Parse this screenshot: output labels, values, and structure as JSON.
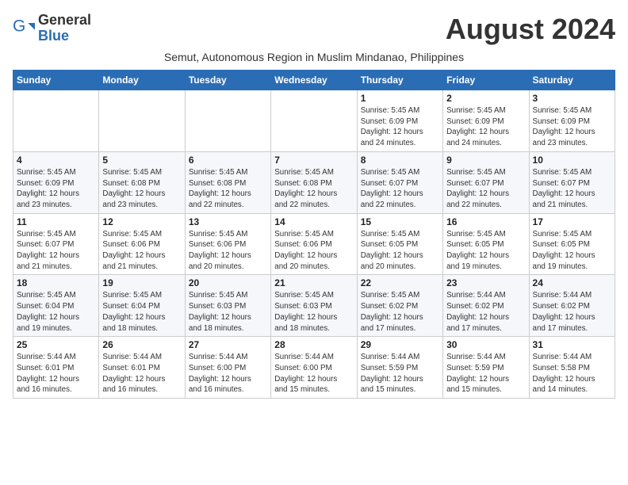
{
  "header": {
    "logo_line1": "General",
    "logo_line2": "Blue",
    "month": "August 2024",
    "subtitle": "Semut, Autonomous Region in Muslim Mindanao, Philippines"
  },
  "days_of_week": [
    "Sunday",
    "Monday",
    "Tuesday",
    "Wednesday",
    "Thursday",
    "Friday",
    "Saturday"
  ],
  "weeks": [
    [
      {
        "day": "",
        "info": ""
      },
      {
        "day": "",
        "info": ""
      },
      {
        "day": "",
        "info": ""
      },
      {
        "day": "",
        "info": ""
      },
      {
        "day": "1",
        "info": "Sunrise: 5:45 AM\nSunset: 6:09 PM\nDaylight: 12 hours\nand 24 minutes."
      },
      {
        "day": "2",
        "info": "Sunrise: 5:45 AM\nSunset: 6:09 PM\nDaylight: 12 hours\nand 24 minutes."
      },
      {
        "day": "3",
        "info": "Sunrise: 5:45 AM\nSunset: 6:09 PM\nDaylight: 12 hours\nand 23 minutes."
      }
    ],
    [
      {
        "day": "4",
        "info": "Sunrise: 5:45 AM\nSunset: 6:09 PM\nDaylight: 12 hours\nand 23 minutes."
      },
      {
        "day": "5",
        "info": "Sunrise: 5:45 AM\nSunset: 6:08 PM\nDaylight: 12 hours\nand 23 minutes."
      },
      {
        "day": "6",
        "info": "Sunrise: 5:45 AM\nSunset: 6:08 PM\nDaylight: 12 hours\nand 22 minutes."
      },
      {
        "day": "7",
        "info": "Sunrise: 5:45 AM\nSunset: 6:08 PM\nDaylight: 12 hours\nand 22 minutes."
      },
      {
        "day": "8",
        "info": "Sunrise: 5:45 AM\nSunset: 6:07 PM\nDaylight: 12 hours\nand 22 minutes."
      },
      {
        "day": "9",
        "info": "Sunrise: 5:45 AM\nSunset: 6:07 PM\nDaylight: 12 hours\nand 22 minutes."
      },
      {
        "day": "10",
        "info": "Sunrise: 5:45 AM\nSunset: 6:07 PM\nDaylight: 12 hours\nand 21 minutes."
      }
    ],
    [
      {
        "day": "11",
        "info": "Sunrise: 5:45 AM\nSunset: 6:07 PM\nDaylight: 12 hours\nand 21 minutes."
      },
      {
        "day": "12",
        "info": "Sunrise: 5:45 AM\nSunset: 6:06 PM\nDaylight: 12 hours\nand 21 minutes."
      },
      {
        "day": "13",
        "info": "Sunrise: 5:45 AM\nSunset: 6:06 PM\nDaylight: 12 hours\nand 20 minutes."
      },
      {
        "day": "14",
        "info": "Sunrise: 5:45 AM\nSunset: 6:06 PM\nDaylight: 12 hours\nand 20 minutes."
      },
      {
        "day": "15",
        "info": "Sunrise: 5:45 AM\nSunset: 6:05 PM\nDaylight: 12 hours\nand 20 minutes."
      },
      {
        "day": "16",
        "info": "Sunrise: 5:45 AM\nSunset: 6:05 PM\nDaylight: 12 hours\nand 19 minutes."
      },
      {
        "day": "17",
        "info": "Sunrise: 5:45 AM\nSunset: 6:05 PM\nDaylight: 12 hours\nand 19 minutes."
      }
    ],
    [
      {
        "day": "18",
        "info": "Sunrise: 5:45 AM\nSunset: 6:04 PM\nDaylight: 12 hours\nand 19 minutes."
      },
      {
        "day": "19",
        "info": "Sunrise: 5:45 AM\nSunset: 6:04 PM\nDaylight: 12 hours\nand 18 minutes."
      },
      {
        "day": "20",
        "info": "Sunrise: 5:45 AM\nSunset: 6:03 PM\nDaylight: 12 hours\nand 18 minutes."
      },
      {
        "day": "21",
        "info": "Sunrise: 5:45 AM\nSunset: 6:03 PM\nDaylight: 12 hours\nand 18 minutes."
      },
      {
        "day": "22",
        "info": "Sunrise: 5:45 AM\nSunset: 6:02 PM\nDaylight: 12 hours\nand 17 minutes."
      },
      {
        "day": "23",
        "info": "Sunrise: 5:44 AM\nSunset: 6:02 PM\nDaylight: 12 hours\nand 17 minutes."
      },
      {
        "day": "24",
        "info": "Sunrise: 5:44 AM\nSunset: 6:02 PM\nDaylight: 12 hours\nand 17 minutes."
      }
    ],
    [
      {
        "day": "25",
        "info": "Sunrise: 5:44 AM\nSunset: 6:01 PM\nDaylight: 12 hours\nand 16 minutes."
      },
      {
        "day": "26",
        "info": "Sunrise: 5:44 AM\nSunset: 6:01 PM\nDaylight: 12 hours\nand 16 minutes."
      },
      {
        "day": "27",
        "info": "Sunrise: 5:44 AM\nSunset: 6:00 PM\nDaylight: 12 hours\nand 16 minutes."
      },
      {
        "day": "28",
        "info": "Sunrise: 5:44 AM\nSunset: 6:00 PM\nDaylight: 12 hours\nand 15 minutes."
      },
      {
        "day": "29",
        "info": "Sunrise: 5:44 AM\nSunset: 5:59 PM\nDaylight: 12 hours\nand 15 minutes."
      },
      {
        "day": "30",
        "info": "Sunrise: 5:44 AM\nSunset: 5:59 PM\nDaylight: 12 hours\nand 15 minutes."
      },
      {
        "day": "31",
        "info": "Sunrise: 5:44 AM\nSunset: 5:58 PM\nDaylight: 12 hours\nand 14 minutes."
      }
    ]
  ]
}
